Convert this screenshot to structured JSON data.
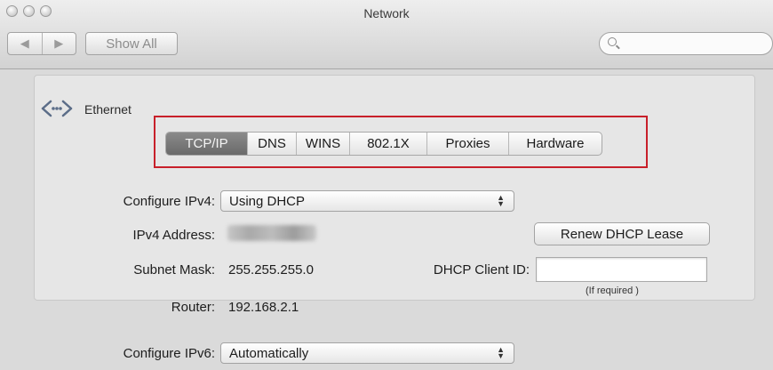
{
  "window": {
    "title": "Network"
  },
  "toolbar": {
    "back_icon": "chevron-left-icon",
    "forward_icon": "chevron-right-icon",
    "show_all_label": "Show All",
    "search_icon": "search-icon"
  },
  "interface": {
    "icon": "ethernet-icon",
    "name": "Ethernet"
  },
  "tabs": [
    {
      "label": "TCP/IP",
      "selected": true
    },
    {
      "label": "DNS",
      "selected": false
    },
    {
      "label": "WINS",
      "selected": false
    },
    {
      "label": "802.1X",
      "selected": false
    },
    {
      "label": "Proxies",
      "selected": false
    },
    {
      "label": "Hardware",
      "selected": false
    }
  ],
  "tcpip": {
    "configure_ipv4": {
      "label": "Configure IPv4:",
      "value": "Using DHCP"
    },
    "ipv4_address": {
      "label": "IPv4 Address:"
    },
    "renew_button": "Renew DHCP Lease",
    "subnet_mask": {
      "label": "Subnet Mask:",
      "value": "255.255.255.0"
    },
    "dhcp_client_id": {
      "label": "DHCP Client ID:",
      "value": "",
      "hint": "(If required )"
    },
    "router": {
      "label": "Router:",
      "value": "192.168.2.1"
    },
    "configure_ipv6": {
      "label": "Configure IPv6:",
      "value": "Automatically"
    }
  },
  "annotation": {
    "highlight_color": "#c8202a"
  }
}
